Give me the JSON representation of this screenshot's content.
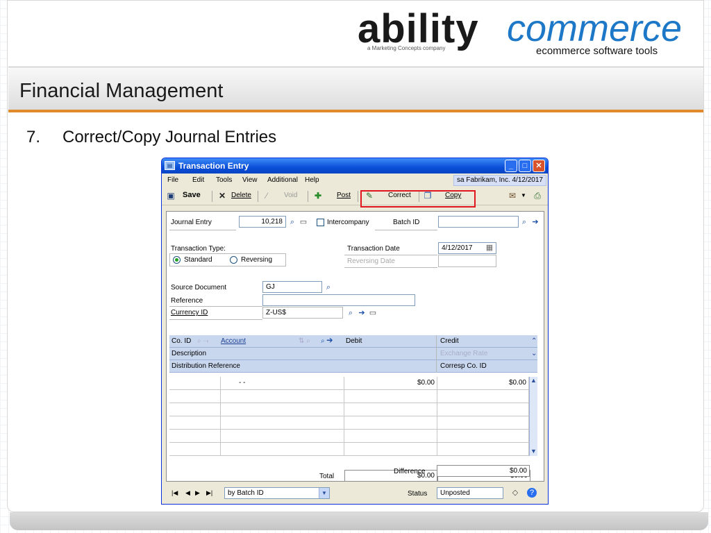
{
  "logo": {
    "brand_ability": "ability",
    "brand_commerce": "commerce",
    "tagline_company": "a Marketing Concepts company",
    "tagline_product": "ecommerce software tools"
  },
  "header": {
    "title": "Financial Management"
  },
  "step": {
    "number": "7.",
    "title": "Correct/Copy Journal Entries"
  },
  "colors": {
    "accent_orange": "#e08a2a",
    "highlight_red": "#e0151e",
    "title_bar_blue": "#0a4fd8",
    "commerce_blue": "#1e78c8"
  },
  "window": {
    "title": "Transaction Entry",
    "menu": [
      "File",
      "Edit",
      "Tools",
      "View",
      "Additional",
      "Help"
    ],
    "company_info": "sa  Fabrikam, Inc.  4/12/2017",
    "toolbar": {
      "save": "Save",
      "delete": "Delete",
      "void": "Void",
      "post": "Post",
      "correct": "Correct",
      "copy": "Copy"
    },
    "form": {
      "journal_entry_label": "Journal Entry",
      "journal_entry_value": "10,218",
      "intercompany_label": "Intercompany",
      "intercompany_checked": false,
      "batch_id_label": "Batch ID",
      "batch_id_value": "",
      "transaction_type_label": "Transaction Type:",
      "type_standard": "Standard",
      "type_reversing": "Reversing",
      "selected_type": "Standard",
      "transaction_date_label": "Transaction Date",
      "transaction_date_value": "4/12/2017",
      "reversing_date_label": "Reversing Date",
      "source_document_label": "Source Document",
      "source_document_value": "GJ",
      "reference_label": "Reference",
      "reference_value": "",
      "currency_id_label": "Currency ID",
      "currency_id_value": "Z-US$"
    },
    "grid": {
      "headers": {
        "co_id": "Co. ID",
        "account": "Account",
        "debit": "Debit",
        "credit": "Credit",
        "description": "Description",
        "exchange_rate": "Exchange Rate",
        "distribution_reference": "Distribution Reference",
        "corresp_co_id": "Corresp Co. ID"
      },
      "rows": [
        {
          "co_id": "",
          "account": "-        -",
          "debit": "$0.00",
          "credit": "$0.00"
        },
        {
          "co_id": "",
          "account": "",
          "debit": "",
          "credit": ""
        },
        {
          "co_id": "",
          "account": "",
          "debit": "",
          "credit": ""
        },
        {
          "co_id": "",
          "account": "",
          "debit": "",
          "credit": ""
        },
        {
          "co_id": "",
          "account": "",
          "debit": "",
          "credit": ""
        },
        {
          "co_id": "",
          "account": "",
          "debit": "",
          "credit": ""
        }
      ]
    },
    "totals": {
      "total_label": "Total",
      "total_debit": "$0.00",
      "total_credit": "$0.00",
      "difference_label": "Difference",
      "difference_value": "$0.00"
    },
    "status": {
      "sort_by": "by Batch ID",
      "status_label": "Status",
      "status_value": "Unposted"
    }
  }
}
